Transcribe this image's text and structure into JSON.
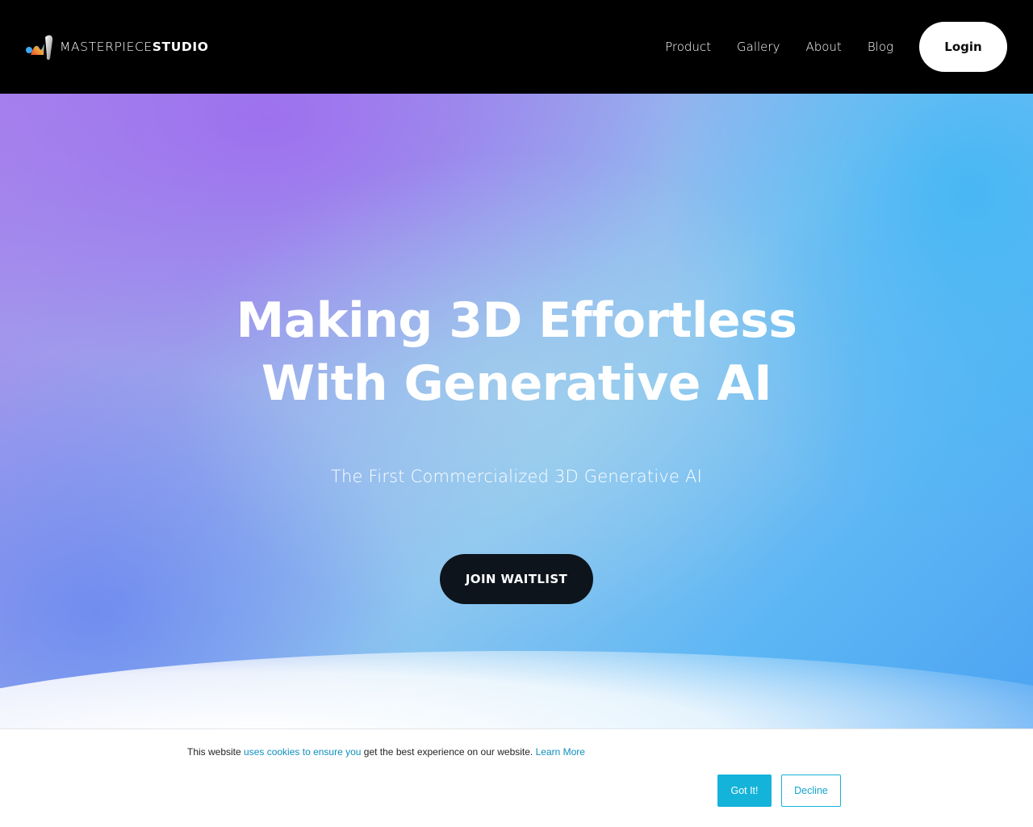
{
  "header": {
    "logo": {
      "icon": "masterpiece-studio-logo-icon",
      "text_light": "MASTERPIECE",
      "text_bold": "STUDIO"
    },
    "nav": [
      {
        "label": "Product"
      },
      {
        "label": "Gallery"
      },
      {
        "label": "About"
      },
      {
        "label": "Blog"
      }
    ],
    "login_label": "Login"
  },
  "hero": {
    "title_line1": "Making 3D Effortless",
    "title_line2": "With Generative AI",
    "subtitle": "The First Commercialized 3D Generative AI",
    "cta_label": "JOIN WAITLIST"
  },
  "cookie": {
    "text_before": "This website ",
    "link_text": "uses cookies to ensure you",
    "text_after": " get the best experience on our website. ",
    "learn_more": "Learn More",
    "accept_label": "Got It!",
    "decline_label": "Decline"
  },
  "colors": {
    "header_bg": "#000000",
    "cta_bg": "#0d141b",
    "cookie_accent": "#14b3d9",
    "cookie_link": "#0f8fbd",
    "hero_purple": "#a987ec",
    "hero_blue": "#4da3f2"
  }
}
